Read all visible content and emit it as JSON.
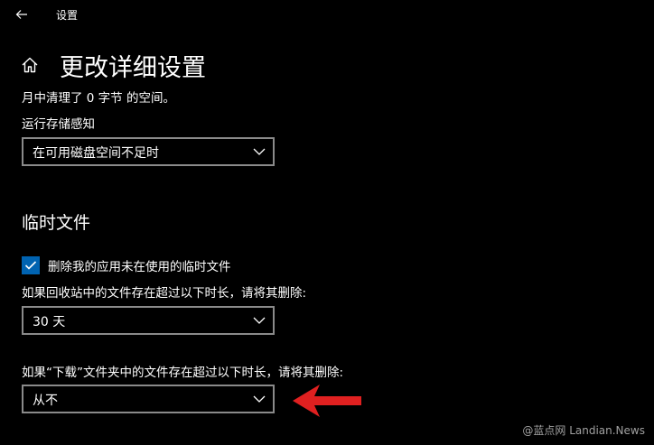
{
  "window": {
    "title": "设置",
    "back_icon": "arrow-left-icon"
  },
  "header": {
    "home_icon": "home-icon",
    "title": "更改详细设置"
  },
  "storage_sense": {
    "freed_text": "月中清理了 0 字节 的空间。",
    "run_label": "运行存储感知",
    "run_value": "在可用磁盘空间不足时"
  },
  "temp_files": {
    "section_title": "临时文件",
    "delete_temp_label": "删除我的应用未在使用的临时文件",
    "delete_temp_checked": true,
    "recycle_label": "如果回收站中的文件存在超过以下时长，请将其删除:",
    "recycle_value": "30 天",
    "downloads_label": "如果“下载”文件夹中的文件存在超过以下时长，请将其删除:",
    "downloads_value": "从不"
  },
  "annotation": {
    "arrow_color": "#e02020"
  },
  "watermark": {
    "text": "@蓝点网 Landian.News"
  },
  "colors": {
    "background": "#000000",
    "accent": "#0063b1",
    "dropdown_border": "#8a8a8a"
  }
}
